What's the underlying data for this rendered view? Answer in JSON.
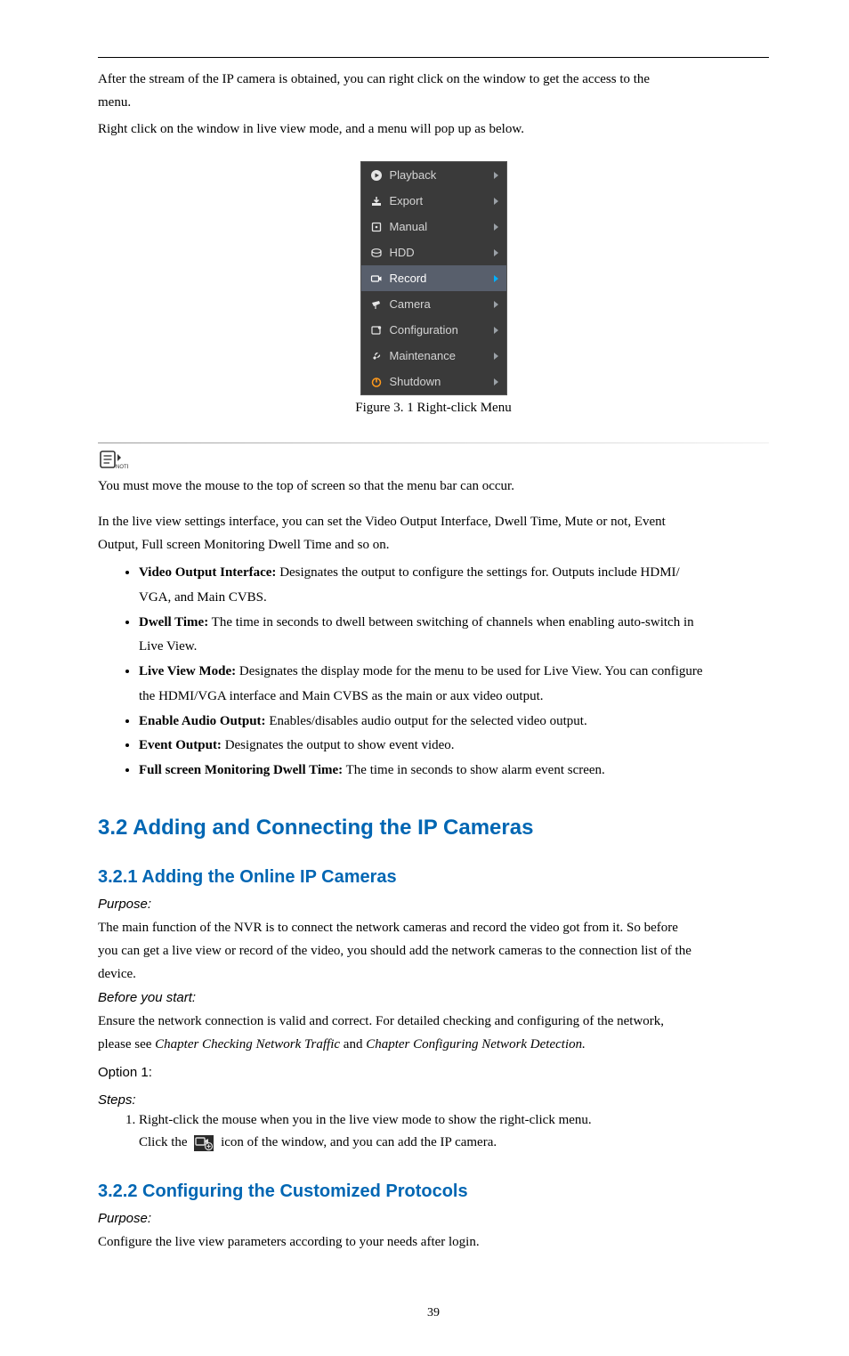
{
  "intro": {
    "line1": "After the stream of the IP camera is obtained, you can right click on the window to get the access to the",
    "line2": "menu.",
    "line3": "Right click on the window in live view mode, and a menu will pop up as below.",
    "menu": {
      "items": [
        {
          "label": "Playback"
        },
        {
          "label": "Export"
        },
        {
          "label": "Manual"
        },
        {
          "label": "HDD"
        },
        {
          "label": "Record",
          "selected": true
        },
        {
          "label": "Camera"
        },
        {
          "label": "Configuration"
        },
        {
          "label": "Maintenance"
        },
        {
          "label": "Shutdown"
        }
      ]
    },
    "caption": "Figure 3. 1 Right-click Menu"
  },
  "note": {
    "icon_label": "NOTE",
    "text": "You must move the mouse to the top of screen so that the menu bar can occur."
  },
  "sec32": {
    "title": "3.2 Adding and Connecting the IP Cameras",
    "sub_title": "3.2.1 Adding the Online IP Cameras",
    "purpose_label": "Purpose:",
    "purpose_text_l1": "The main function of the NVR is to connect the network cameras and record the video got from it. So before",
    "purpose_text_l2": "you can get a live view or record of the video, you should add the network cameras to the connection list of the",
    "purpose_text_l3": "device.",
    "before_label": "Before you start:",
    "before_text": "Ensure the network connection is valid and correct. For detailed checking and configuring of the network,",
    "before_text2": "please see Chapter Checking Network Traffic and Chapter Configuring Network Detection.",
    "option1_label": "Option 1:",
    "steps_label": "Steps:",
    "step1": "Right-click the mouse when you in the live view mode to show the right-click menu.",
    "step2_a": "Click the    ",
    "step2_b": "   icon of the window, and you can add the IP camera."
  },
  "sec321_cont": {
    "sub2_title": "3.2.2 Configuring the Customized Protocols",
    "purpose_label": "Purpose:",
    "purpose_text": "Configure the live view parameters according to your needs after login.",
    "settings_intro_l1": "In the live view settings interface, you can set the Video Output Interface, Dwell Time, Mute or not, Event",
    "settings_intro_l2": "Output, Full screen Monitoring Dwell Time and so on.",
    "bullets": [
      {
        "lead": "Video Output Interface:",
        "rest": " Designates the output to configure the settings for. Outputs include HDMI/",
        "rest_l2": "VGA, and Main CVBS."
      },
      {
        "lead": "Dwell Time:",
        "rest": " The time in seconds to dwell between switching of channels when enabling auto-switch in",
        "rest_l2": "Live View."
      },
      {
        "lead": "Live View Mode:",
        "rest": " Designates the display mode for the menu to be used for Live View. You can configure",
        "rest_l2": "the HDMI/VGA interface and Main CVBS as the main or aux video output."
      },
      {
        "lead": "Enable Audio Output:",
        "rest": " Enables/disables audio output for the selected video output."
      },
      {
        "lead": "Event Output:",
        "rest": " Designates the output to show event video."
      },
      {
        "lead": "Full screen Monitoring Dwell Time:",
        "rest": " The time in seconds to show alarm event screen."
      }
    ]
  },
  "page_number": "39"
}
